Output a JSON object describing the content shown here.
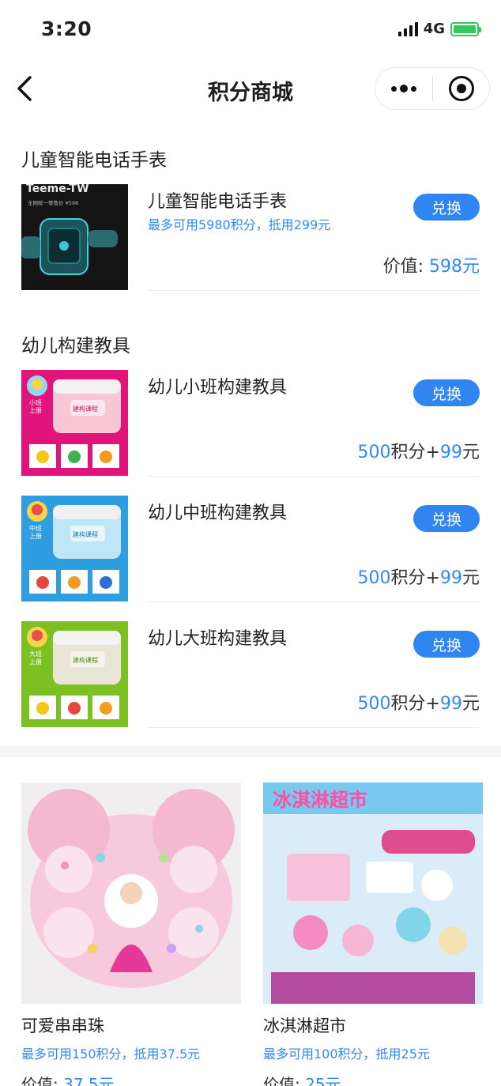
{
  "status_bar": {
    "time": "3:20",
    "network": "4G"
  },
  "nav": {
    "title": "积分商城"
  },
  "sections": [
    {
      "title": "儿童智能电话手表",
      "items": [
        {
          "name": "儿童智能电话手表",
          "sub": "最多可用5980积分，抵用299元",
          "button": "兑换",
          "price_label": "价值: ",
          "price_value": "598元",
          "thumb_text": "全网统一零售价 ¥598",
          "thumb_brand": "Teeme-TW"
        }
      ]
    },
    {
      "title": "幼儿构建教具",
      "items": [
        {
          "name": "幼儿小班构建教具",
          "button": "兑换",
          "points": "500",
          "points_unit": "积分+",
          "cash": "99",
          "cash_unit": "元",
          "thumb_tag": "小班\n上册",
          "thumb_label": "建构课程"
        },
        {
          "name": "幼儿中班构建教具",
          "button": "兑换",
          "points": "500",
          "points_unit": "积分+",
          "cash": "99",
          "cash_unit": "元",
          "thumb_tag": "中班\n上册",
          "thumb_label": "建构课程"
        },
        {
          "name": "幼儿大班构建教具",
          "button": "兑换",
          "points": "500",
          "points_unit": "积分+",
          "cash": "99",
          "cash_unit": "元",
          "thumb_tag": "大班\n上册",
          "thumb_label": "建构课程"
        }
      ]
    }
  ],
  "grid": [
    {
      "name": "可爱串串珠",
      "sub": "最多可用150积分，抵用37.5元",
      "value_label": "价值: ",
      "value": "37.5元"
    },
    {
      "name": "冰淇淋超市",
      "sub": "最多可用100积分，抵用25元",
      "value_label": "价值: ",
      "value": "25元"
    }
  ],
  "colors": {
    "accent": "#2f86f0",
    "link_text": "#2f8af5",
    "pink_bg": "#e0147a",
    "blue_bg": "#2e9ee0",
    "green_bg": "#7cc021"
  },
  "icons": [
    "back-arrow-icon",
    "more-dots-icon",
    "close-target-icon",
    "signal-icon",
    "battery-icon"
  ]
}
